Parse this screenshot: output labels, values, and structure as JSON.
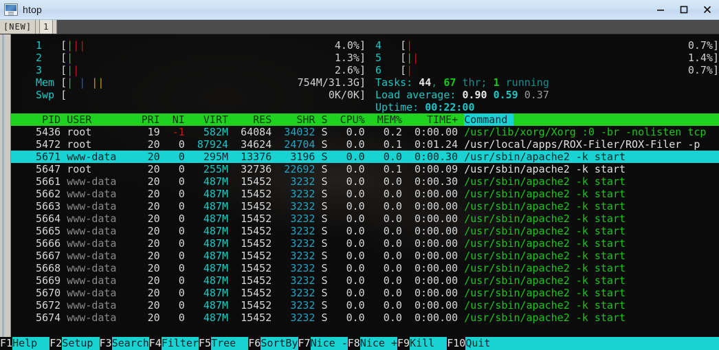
{
  "window": {
    "title": "htop",
    "icon": "terminal-monitor-icon",
    "controls": [
      {
        "name": "minimize-button",
        "glyph": "minimize-icon"
      },
      {
        "name": "maximize-button",
        "glyph": "maximize-icon"
      },
      {
        "name": "close-button",
        "glyph": "close-icon"
      }
    ]
  },
  "tabs": {
    "new_label": "[NEW]",
    "items": [
      {
        "label": "1",
        "active": true
      }
    ]
  },
  "meters": {
    "left": [
      {
        "label": "1",
        "bars": [
          {
            "ch": "|",
            "color": "green"
          },
          {
            "ch": "|",
            "color": "red"
          },
          {
            "ch": "|",
            "color": "red"
          }
        ],
        "blank": 28,
        "value": "4.0%"
      },
      {
        "label": "2",
        "bars": [
          {
            "ch": "|",
            "color": "green"
          }
        ],
        "blank": 30,
        "value": "1.3%"
      },
      {
        "label": "3",
        "bars": [
          {
            "ch": "|",
            "color": "green"
          },
          {
            "ch": "|",
            "color": "red"
          }
        ],
        "blank": 29,
        "value": "2.6%"
      },
      {
        "label": "Mem",
        "bars": [
          {
            "ch": "|",
            "color": "green"
          },
          {
            "ch": " ",
            "color": "blank"
          },
          {
            "ch": "|",
            "color": "blue"
          },
          {
            "ch": " ",
            "color": "blank"
          },
          {
            "ch": "|",
            "color": "yellow"
          },
          {
            "ch": "|",
            "color": "yellow"
          }
        ],
        "blank": 22,
        "value": "754M/31.3G"
      },
      {
        "label": "Swp",
        "bars": [],
        "blank": 26,
        "value": "0K/0K"
      }
    ],
    "right": [
      {
        "label": "4",
        "bars": [
          {
            "ch": "|",
            "color": "red"
          }
        ],
        "blank": 30,
        "value": "0.7%"
      },
      {
        "label": "5",
        "bars": [
          {
            "ch": "|",
            "color": "green"
          },
          {
            "ch": "|",
            "color": "red"
          }
        ],
        "blank": 29,
        "value": "1.4%"
      },
      {
        "label": "6",
        "bars": [
          {
            "ch": "|",
            "color": "red"
          }
        ],
        "blank": 30,
        "value": "0.7%"
      }
    ],
    "info": {
      "tasks_label": "Tasks: ",
      "tasks_count": "44",
      "tasks_sep": ", ",
      "threads_count": "67",
      "threads_label": " thr; ",
      "running_count": "1",
      "running_label": " running",
      "load_label": "Load average: ",
      "load_1": "0.90",
      "load_5": "0.59",
      "load_15": "0.37",
      "uptime_label": "Uptime: ",
      "uptime_value": "00:22:00"
    }
  },
  "table": {
    "columns": [
      "PID",
      "USER",
      "PRI",
      "NI",
      "VIRT",
      "RES",
      "SHR",
      "S",
      "CPU%",
      "MEM%",
      "TIME+",
      "Command"
    ],
    "sorted_column": "Command",
    "rows": [
      {
        "pid": "5436",
        "user": "root",
        "user_dim": false,
        "pri": "19",
        "ni": "-1",
        "ni_neg": true,
        "virt": "582M",
        "res": "64084",
        "shr": "34032",
        "s": "S",
        "cpu": "0.0",
        "mem": "0.2",
        "time": "0:00.00",
        "cmd": "/usr/lib/xorg/Xorg :0 -br -nolisten tcp",
        "cmd_green": true,
        "selected": false
      },
      {
        "pid": "5472",
        "user": "root",
        "user_dim": false,
        "pri": "20",
        "ni": "0",
        "ni_neg": false,
        "virt": "87924",
        "res": "34624",
        "shr": "24704",
        "s": "S",
        "cpu": "0.0",
        "mem": "0.1",
        "time": "0:01.24",
        "cmd": "/usr/local/apps/ROX-Filer/ROX-Filer -p",
        "cmd_green": false,
        "selected": false
      },
      {
        "pid": "5671",
        "user": "www-data",
        "user_dim": false,
        "pri": "20",
        "ni": "0",
        "ni_neg": false,
        "virt": "295M",
        "res": "13376",
        "shr": "3196",
        "s": "S",
        "cpu": "0.0",
        "mem": "0.0",
        "time": "0:00.30",
        "cmd": "/usr/sbin/apache2 -k start",
        "cmd_green": false,
        "selected": true
      },
      {
        "pid": "5647",
        "user": "root",
        "user_dim": false,
        "pri": "20",
        "ni": "0",
        "ni_neg": false,
        "virt": "255M",
        "res": "32736",
        "shr": "22692",
        "s": "S",
        "cpu": "0.0",
        "mem": "0.1",
        "time": "0:00.09",
        "cmd": "/usr/sbin/apache2 -k start",
        "cmd_green": false,
        "selected": false
      },
      {
        "pid": "5661",
        "user": "www-data",
        "user_dim": true,
        "pri": "20",
        "ni": "0",
        "ni_neg": false,
        "virt": "487M",
        "res": "15452",
        "shr": "3232",
        "s": "S",
        "cpu": "0.0",
        "mem": "0.0",
        "time": "0:00.30",
        "cmd": "/usr/sbin/apache2 -k start",
        "cmd_green": true,
        "selected": false
      },
      {
        "pid": "5662",
        "user": "www-data",
        "user_dim": true,
        "pri": "20",
        "ni": "0",
        "ni_neg": false,
        "virt": "487M",
        "res": "15452",
        "shr": "3232",
        "s": "S",
        "cpu": "0.0",
        "mem": "0.0",
        "time": "0:00.00",
        "cmd": "/usr/sbin/apache2 -k start",
        "cmd_green": true,
        "selected": false
      },
      {
        "pid": "5663",
        "user": "www-data",
        "user_dim": true,
        "pri": "20",
        "ni": "0",
        "ni_neg": false,
        "virt": "487M",
        "res": "15452",
        "shr": "3232",
        "s": "S",
        "cpu": "0.0",
        "mem": "0.0",
        "time": "0:00.00",
        "cmd": "/usr/sbin/apache2 -k start",
        "cmd_green": true,
        "selected": false
      },
      {
        "pid": "5664",
        "user": "www-data",
        "user_dim": true,
        "pri": "20",
        "ni": "0",
        "ni_neg": false,
        "virt": "487M",
        "res": "15452",
        "shr": "3232",
        "s": "S",
        "cpu": "0.0",
        "mem": "0.0",
        "time": "0:00.00",
        "cmd": "/usr/sbin/apache2 -k start",
        "cmd_green": true,
        "selected": false
      },
      {
        "pid": "5665",
        "user": "www-data",
        "user_dim": true,
        "pri": "20",
        "ni": "0",
        "ni_neg": false,
        "virt": "487M",
        "res": "15452",
        "shr": "3232",
        "s": "S",
        "cpu": "0.0",
        "mem": "0.0",
        "time": "0:00.00",
        "cmd": "/usr/sbin/apache2 -k start",
        "cmd_green": true,
        "selected": false
      },
      {
        "pid": "5666",
        "user": "www-data",
        "user_dim": true,
        "pri": "20",
        "ni": "0",
        "ni_neg": false,
        "virt": "487M",
        "res": "15452",
        "shr": "3232",
        "s": "S",
        "cpu": "0.0",
        "mem": "0.0",
        "time": "0:00.00",
        "cmd": "/usr/sbin/apache2 -k start",
        "cmd_green": true,
        "selected": false
      },
      {
        "pid": "5667",
        "user": "www-data",
        "user_dim": true,
        "pri": "20",
        "ni": "0",
        "ni_neg": false,
        "virt": "487M",
        "res": "15452",
        "shr": "3232",
        "s": "S",
        "cpu": "0.0",
        "mem": "0.0",
        "time": "0:00.00",
        "cmd": "/usr/sbin/apache2 -k start",
        "cmd_green": true,
        "selected": false
      },
      {
        "pid": "5668",
        "user": "www-data",
        "user_dim": true,
        "pri": "20",
        "ni": "0",
        "ni_neg": false,
        "virt": "487M",
        "res": "15452",
        "shr": "3232",
        "s": "S",
        "cpu": "0.0",
        "mem": "0.0",
        "time": "0:00.00",
        "cmd": "/usr/sbin/apache2 -k start",
        "cmd_green": true,
        "selected": false
      },
      {
        "pid": "5669",
        "user": "www-data",
        "user_dim": true,
        "pri": "20",
        "ni": "0",
        "ni_neg": false,
        "virt": "487M",
        "res": "15452",
        "shr": "3232",
        "s": "S",
        "cpu": "0.0",
        "mem": "0.0",
        "time": "0:00.00",
        "cmd": "/usr/sbin/apache2 -k start",
        "cmd_green": true,
        "selected": false
      },
      {
        "pid": "5670",
        "user": "www-data",
        "user_dim": true,
        "pri": "20",
        "ni": "0",
        "ni_neg": false,
        "virt": "487M",
        "res": "15452",
        "shr": "3232",
        "s": "S",
        "cpu": "0.0",
        "mem": "0.0",
        "time": "0:00.00",
        "cmd": "/usr/sbin/apache2 -k start",
        "cmd_green": true,
        "selected": false
      },
      {
        "pid": "5672",
        "user": "www-data",
        "user_dim": true,
        "pri": "20",
        "ni": "0",
        "ni_neg": false,
        "virt": "487M",
        "res": "15452",
        "shr": "3232",
        "s": "S",
        "cpu": "0.0",
        "mem": "0.0",
        "time": "0:00.00",
        "cmd": "/usr/sbin/apache2 -k start",
        "cmd_green": true,
        "selected": false
      },
      {
        "pid": "5674",
        "user": "www-data",
        "user_dim": true,
        "pri": "20",
        "ni": "0",
        "ni_neg": false,
        "virt": "487M",
        "res": "15452",
        "shr": "3232",
        "s": "S",
        "cpu": "0.0",
        "mem": "0.0",
        "time": "0:00.00",
        "cmd": "/usr/sbin/apache2 -k start",
        "cmd_green": true,
        "selected": false
      }
    ]
  },
  "function_keys": [
    {
      "key": "F1",
      "label": "Help  "
    },
    {
      "key": "F2",
      "label": "Setup "
    },
    {
      "key": "F3",
      "label": "Search"
    },
    {
      "key": "F4",
      "label": "Filter"
    },
    {
      "key": "F5",
      "label": "Tree  "
    },
    {
      "key": "F6",
      "label": "SortBy"
    },
    {
      "key": "F7",
      "label": "Nice -"
    },
    {
      "key": "F8",
      "label": "Nice +"
    },
    {
      "key": "F9",
      "label": "Kill  "
    },
    {
      "key": "F10",
      "label": "Quit  "
    }
  ],
  "colors": {
    "header_green": "#1fd21f",
    "highlight_cyan": "#19d2d2",
    "meter_label_cyan": "#19c8c8",
    "bar_green": "#19c819",
    "bar_red": "#c81919",
    "bar_blue": "#2a4fd8",
    "bar_yellow": "#c8a019",
    "titlebar_blue": "#cde0f4",
    "terminal_bg": "#0b0b0b"
  }
}
